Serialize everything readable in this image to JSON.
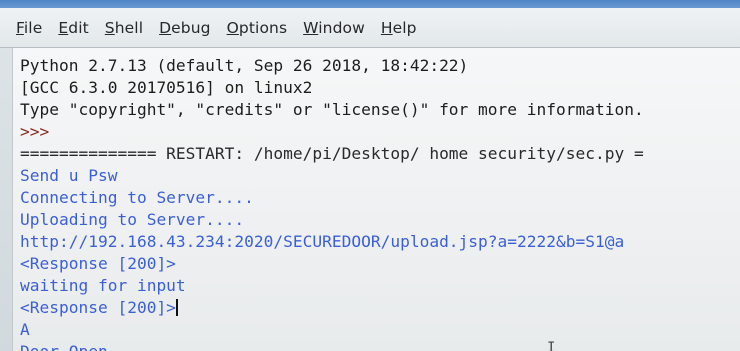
{
  "menu": {
    "items": [
      "File",
      "Edit",
      "Shell",
      "Debug",
      "Options",
      "Window",
      "Help"
    ]
  },
  "shell": {
    "lines": [
      {
        "text": "Python 2.7.13 (default, Sep 26 2018, 18:42:22)",
        "kind": "stdout"
      },
      {
        "text": "[GCC 6.3.0 20170516] on linux2",
        "kind": "stdout"
      },
      {
        "text": "Type \"copyright\", \"credits\" or \"license()\" for more information.",
        "kind": "stdout"
      },
      {
        "text": ">>>",
        "kind": "prompt"
      },
      {
        "text": "============== RESTART: /home/pi/Desktop/ home security/sec.py =",
        "kind": "restart"
      },
      {
        "text": "Send u Psw",
        "kind": "output"
      },
      {
        "text": "Connecting to Server....",
        "kind": "output"
      },
      {
        "text": "Uploading to Server....",
        "kind": "output"
      },
      {
        "text": "http://192.168.43.234:2020/SECUREDOOR/upload.jsp?a=2222&b=S1@a",
        "kind": "output"
      },
      {
        "text": "<Response [200]>",
        "kind": "output"
      },
      {
        "text": "waiting for input",
        "kind": "output"
      },
      {
        "text": "<Response [200]>",
        "kind": "output"
      },
      {
        "text": "A",
        "kind": "output"
      },
      {
        "text": "Door Open",
        "kind": "output"
      }
    ]
  },
  "colors": {
    "stdout": "#1d1d1d",
    "prompt": "#8a2b22",
    "output": "#3c5fd6",
    "background": "#f6f7f8",
    "title_strip": "#4f85c7"
  },
  "icons": {
    "mouse_pointer": "i-beam-cursor-icon"
  }
}
